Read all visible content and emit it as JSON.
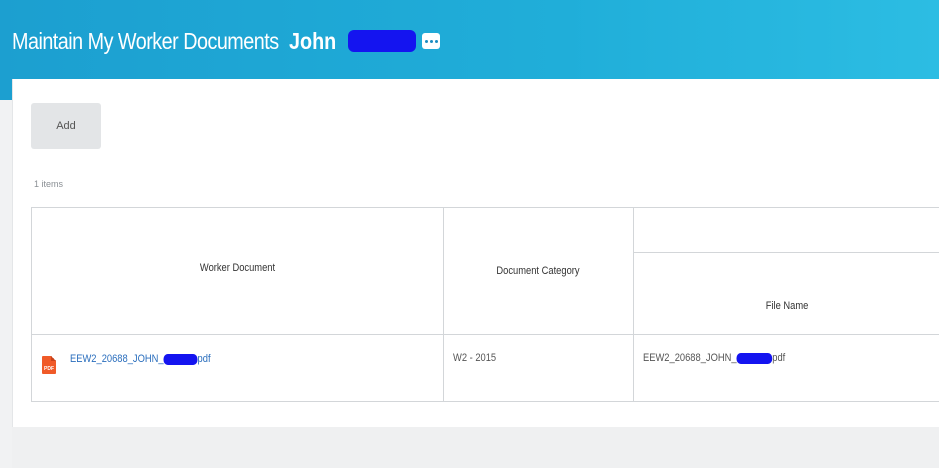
{
  "header": {
    "title": "Maintain My Worker Documents",
    "worker_name": "John",
    "related_actions_icon": "ellipsis-icon"
  },
  "toolbar": {
    "add_label": "Add"
  },
  "grid": {
    "items_count": "1 items",
    "columns": {
      "worker_document": "Worker Document",
      "document_category": "Document Category",
      "file_name": "File Name"
    },
    "rows": [
      {
        "worker_document": "EEW2_20688_JOHN_",
        "worker_document_suffix": "pdf",
        "document_category": "W2 - 2015",
        "file_name": "EEW2_20688_JOHN_",
        "file_name_suffix": "pdf",
        "icon": "pdf-icon",
        "icon_label": "PDF"
      }
    ]
  },
  "colors": {
    "header_start": "#1c9fd0",
    "header_end": "#2cbde3",
    "link": "#2a6ebd",
    "redaction": "#1414f0",
    "pdf_icon": "#f05a28"
  }
}
